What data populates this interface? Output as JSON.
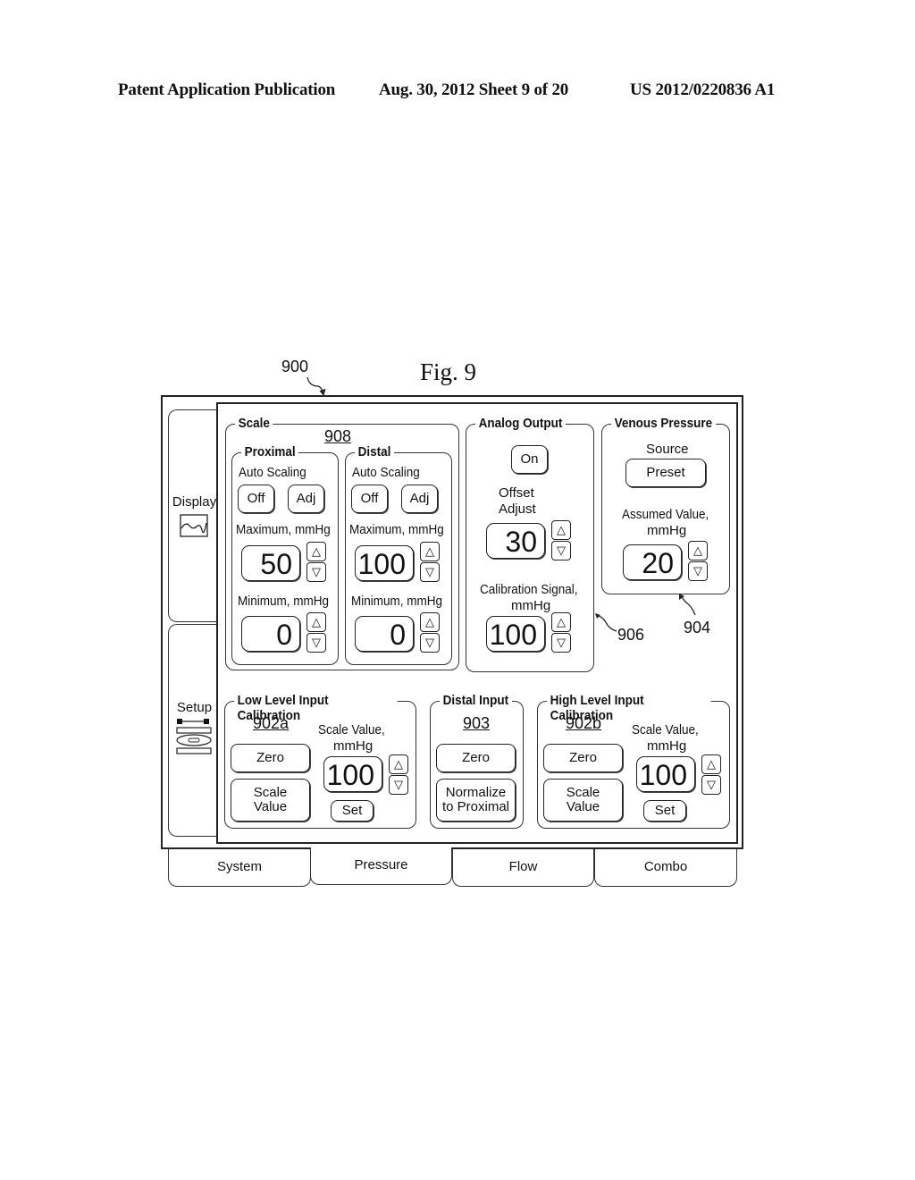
{
  "header": {
    "publication": "Patent Application Publication",
    "date_sheet": "Aug. 30, 2012  Sheet 9 of 20",
    "number": "US 2012/0220836 A1"
  },
  "figure": {
    "title": "Fig. 9",
    "refs": {
      "r900": "900",
      "r908": "908",
      "r906": "906",
      "r904": "904",
      "r902a": "902a",
      "r903": "903",
      "r902b": "902b"
    }
  },
  "sidebar": {
    "items": [
      {
        "label": "Display",
        "icon": "waveform-icon"
      },
      {
        "label": "Setup",
        "icon": "setup-icon"
      }
    ]
  },
  "scale": {
    "title": "Scale",
    "proximal": {
      "title": "Proximal",
      "auto_scaling": "Auto Scaling",
      "off": "Off",
      "adj": "Adj",
      "max_label": "Maximum, mmHg",
      "max_value": "50",
      "min_label": "Minimum, mmHg",
      "min_value": "0"
    },
    "distal": {
      "title": "Distal",
      "auto_scaling": "Auto Scaling",
      "off": "Off",
      "adj": "Adj",
      "max_label": "Maximum, mmHg",
      "max_value": "100",
      "min_label": "Minimum, mmHg",
      "min_value": "0"
    }
  },
  "analog_output": {
    "title": "Analog Output",
    "on": "On",
    "offset_label_1": "Offset",
    "offset_label_2": "Adjust",
    "offset_value": "30",
    "cal_label_1": "Calibration Signal,",
    "cal_label_2": "mmHg",
    "cal_value": "100"
  },
  "venous": {
    "title": "Venous Pressure",
    "source_label": "Source",
    "source_value": "Preset",
    "assumed_label_1": "Assumed Value,",
    "assumed_label_2": "mmHg",
    "assumed_value": "20"
  },
  "low_cal": {
    "title": "Low Level Input Calibration",
    "zero": "Zero",
    "scale_value_1": "Scale",
    "scale_value_2": "Value",
    "sv_label_1": "Scale Value,",
    "sv_label_2": "mmHg",
    "value": "100",
    "set": "Set"
  },
  "distal_input": {
    "title": "Distal Input",
    "zero": "Zero",
    "normalize_1": "Normalize",
    "normalize_2": "to Proximal"
  },
  "high_cal": {
    "title": "High Level Input Calibration",
    "zero": "Zero",
    "scale_value_1": "Scale",
    "scale_value_2": "Value",
    "sv_label_1": "Scale Value,",
    "sv_label_2": "mmHg",
    "value": "100",
    "set": "Set"
  },
  "tabs": [
    {
      "label": "System"
    },
    {
      "label": "Pressure",
      "active": true
    },
    {
      "label": "Flow"
    },
    {
      "label": "Combo"
    }
  ],
  "arrows": {
    "up": "△",
    "down": "▽"
  }
}
